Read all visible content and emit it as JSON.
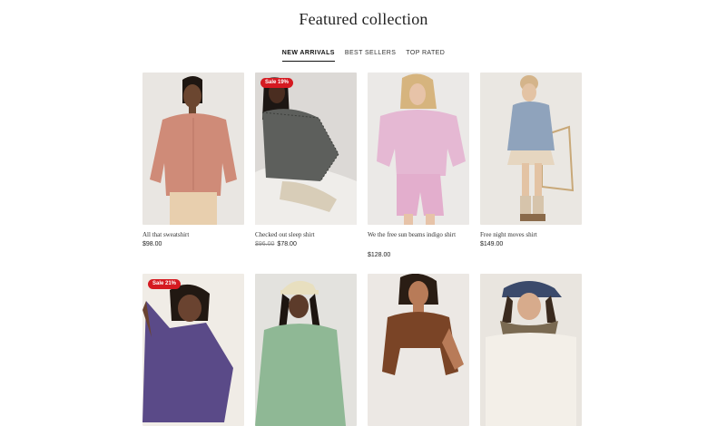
{
  "section": {
    "title": "Featured collection"
  },
  "tabs": [
    {
      "label": "NEW ARRIVALS",
      "active": true
    },
    {
      "label": "BEST SELLERS",
      "active": false
    },
    {
      "label": "TOP RATED",
      "active": false
    }
  ],
  "colors": {
    "sale_badge": "#d51a21",
    "text": "#1a1a1a",
    "muted": "#888888"
  },
  "products": [
    {
      "name": "All that sweatshirt",
      "price": "$98.00",
      "compare_price": "",
      "badge": "",
      "image": "model-pink-sweatshirt"
    },
    {
      "name": "Checked out sleep shirt",
      "price": "$78.00",
      "compare_price": "$96.00",
      "badge": "Sale 19%",
      "image": "model-checked-shirt"
    },
    {
      "name": "We the free sun beams indigo shirt",
      "price": "$128.00",
      "compare_price": "",
      "badge": "",
      "image": "model-lilac-shirt-shorts"
    },
    {
      "name": "Free night moves shirt",
      "price": "$149.00",
      "compare_price": "",
      "badge": "",
      "image": "model-denim-shirt-chair"
    },
    {
      "name": "",
      "price": "",
      "compare_price": "",
      "badge": "Sale 21%",
      "image": "model-purple-sweater"
    },
    {
      "name": "",
      "price": "",
      "compare_price": "",
      "badge": "",
      "image": "model-green-top-cap"
    },
    {
      "name": "",
      "price": "",
      "compare_price": "",
      "badge": "",
      "image": "model-brown-top"
    },
    {
      "name": "",
      "price": "",
      "compare_price": "",
      "badge": "",
      "image": "model-navy-cap-scarf"
    }
  ]
}
